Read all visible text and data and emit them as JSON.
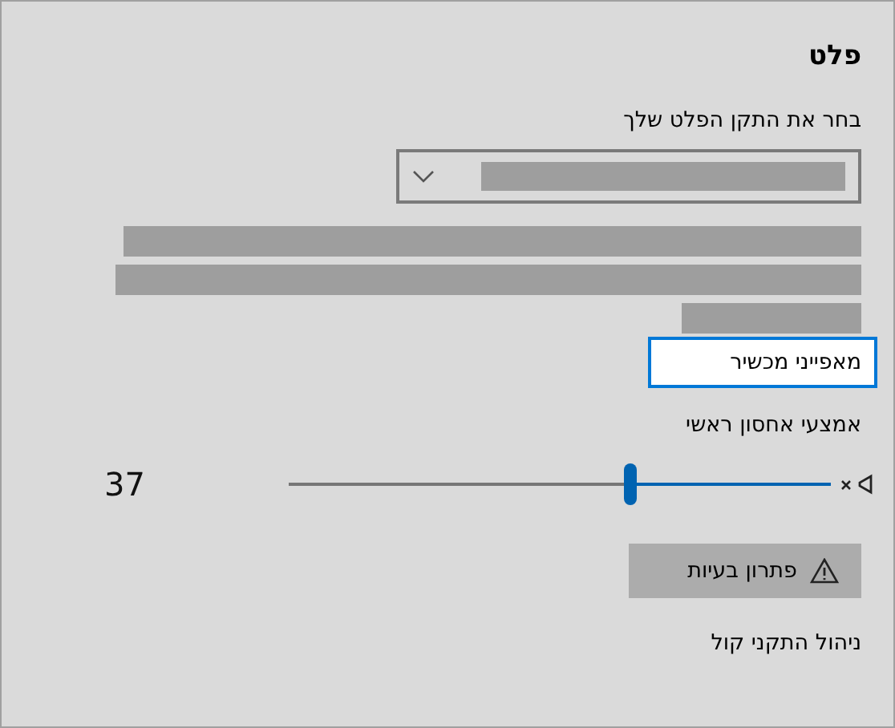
{
  "title": "פלט",
  "device_label": "בחר את התקן הפלט שלך",
  "properties_link": "מאפייני מכשיר",
  "volume": {
    "label": "אמצעי אחסון ראשי",
    "muted": true,
    "level": 0.37,
    "reading": "37"
  },
  "troubleshoot_button": "פתרון בעיות",
  "manage_link": "ניהול התקני קול"
}
